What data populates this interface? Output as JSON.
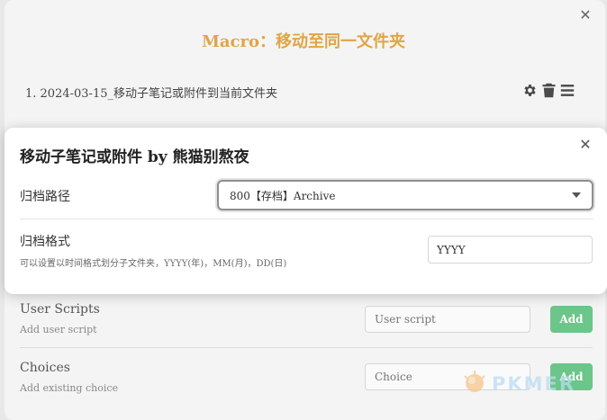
{
  "background_modal": {
    "title": "Macro：移动至同一文件夹",
    "command": "1. 2024-03-15_移动子笔记或附件到当前文件夹",
    "actions": {
      "settings_icon": "gear-icon",
      "delete_icon": "trash-icon",
      "drag_icon": "drag-handle-icon"
    },
    "user_scripts": {
      "title": "User Scripts",
      "description": "Add user script",
      "placeholder": "User script",
      "add_label": "Add"
    },
    "choices": {
      "title": "Choices",
      "description": "Add existing choice",
      "placeholder": "Choice",
      "add_label": "Add"
    }
  },
  "modal": {
    "title": "移动子笔记或附件 by 熊猫别熬夜",
    "archive_path": {
      "label": "归档路径",
      "selected": "800【存档】Archive"
    },
    "archive_format": {
      "label": "归档格式",
      "description": "可以设置以时间格式划分子文件夹，YYYY(年)，MM(月)，DD(日)",
      "value": "YYYY"
    }
  },
  "watermark": {
    "text": "PKMER"
  },
  "colors": {
    "title_accent": "#e0a545",
    "add_button": "#6cc589",
    "watermark": "#bcdcf2"
  }
}
